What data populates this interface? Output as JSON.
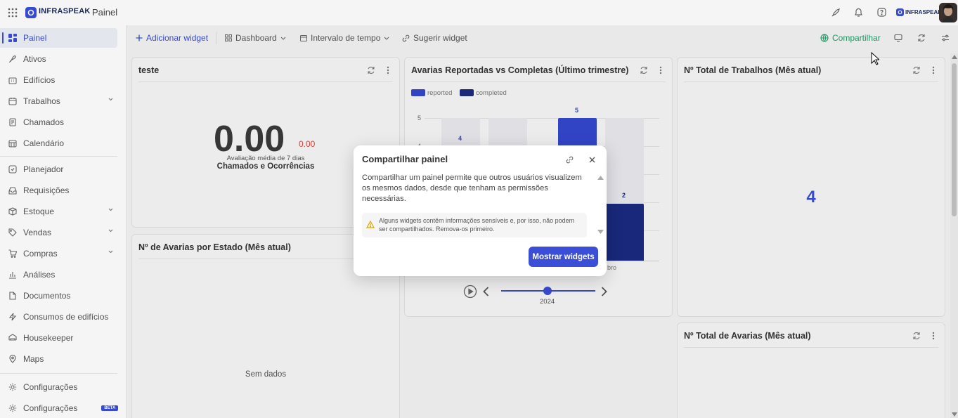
{
  "app": {
    "brand": "INFRASPEAK",
    "title": "Painel"
  },
  "colors": {
    "accent": "#3b4ed8",
    "share_green": "#1e9e6a",
    "reported": "#3547cf",
    "completed": "#1b2a80",
    "ghost_bar": "#e9e9ee",
    "negative": "#e0443a"
  },
  "sidebar": {
    "items": [
      {
        "label": "Painel",
        "icon": "dashboard-icon",
        "active": true
      },
      {
        "label": "Ativos",
        "icon": "assets-icon"
      },
      {
        "label": "Edifícios",
        "icon": "building-icon"
      },
      {
        "label": "Trabalhos",
        "icon": "calendar-icon",
        "expandable": true
      },
      {
        "label": "Chamados",
        "icon": "clipboard-icon"
      },
      {
        "label": "Calendário",
        "icon": "calendar-grid-icon"
      },
      {
        "label": "Planejador",
        "icon": "planner-icon"
      },
      {
        "label": "Requisições",
        "icon": "inbox-icon"
      },
      {
        "label": "Estoque",
        "icon": "stock-icon",
        "expandable": true
      },
      {
        "label": "Vendas",
        "icon": "tag-icon",
        "expandable": true
      },
      {
        "label": "Compras",
        "icon": "cart-icon",
        "expandable": true
      },
      {
        "label": "Análises",
        "icon": "bar-chart-icon"
      },
      {
        "label": "Documentos",
        "icon": "document-icon"
      },
      {
        "label": "Consumos de edifícios",
        "icon": "lightning-icon"
      },
      {
        "label": "Housekeeper",
        "icon": "bed-icon"
      },
      {
        "label": "Maps",
        "icon": "map-pin-icon"
      },
      {
        "label": "Configurações",
        "icon": "gear-icon"
      },
      {
        "label": "Configurações",
        "icon": "gear-icon",
        "badge": "BETA"
      }
    ]
  },
  "toolbar": {
    "add_widget": "Adicionar widget",
    "dashboard": "Dashboard",
    "time_range": "Intervalo de tempo",
    "suggest_widget": "Sugerir widget",
    "share": "Compartilhar"
  },
  "cards": {
    "teste": {
      "title": "teste",
      "big_value": "0.00",
      "delta": "0.00",
      "caption": "Avaliação média de 7 dias",
      "subtitle": "Chamados e Ocorrências"
    },
    "avarias_estado": {
      "title": "Nº de Avarias por Estado (Mês atual)",
      "empty": "Sem dados"
    },
    "reported_vs_completed": {
      "title": "Avarias Reportadas vs Completas (Último trimestre)",
      "legend": [
        "reported",
        "completed"
      ],
      "tick_top": "5",
      "tick_partial": "4",
      "label_5": "5",
      "label_4": "4",
      "label_2": "2",
      "visible_axis_fragment": "bro",
      "year": "2024",
      "slider_position": 0.5
    },
    "total_trabalhos": {
      "title": "Nº Total de Trabalhos (Mês atual)",
      "value": "4"
    },
    "total_avarias": {
      "title": "Nº Total de Avarias (Mês atual)"
    }
  },
  "modal": {
    "title": "Compartilhar painel",
    "body": "Compartilhar um painel permite que outros usuários visualizem os mesmos dados, desde que tenham as permissões necessárias.",
    "warning": "Alguns widgets contêm informações sensíveis e, por isso, não podem ser compartilhados. Remova-os primeiro.",
    "button": "Mostrar widgets"
  }
}
